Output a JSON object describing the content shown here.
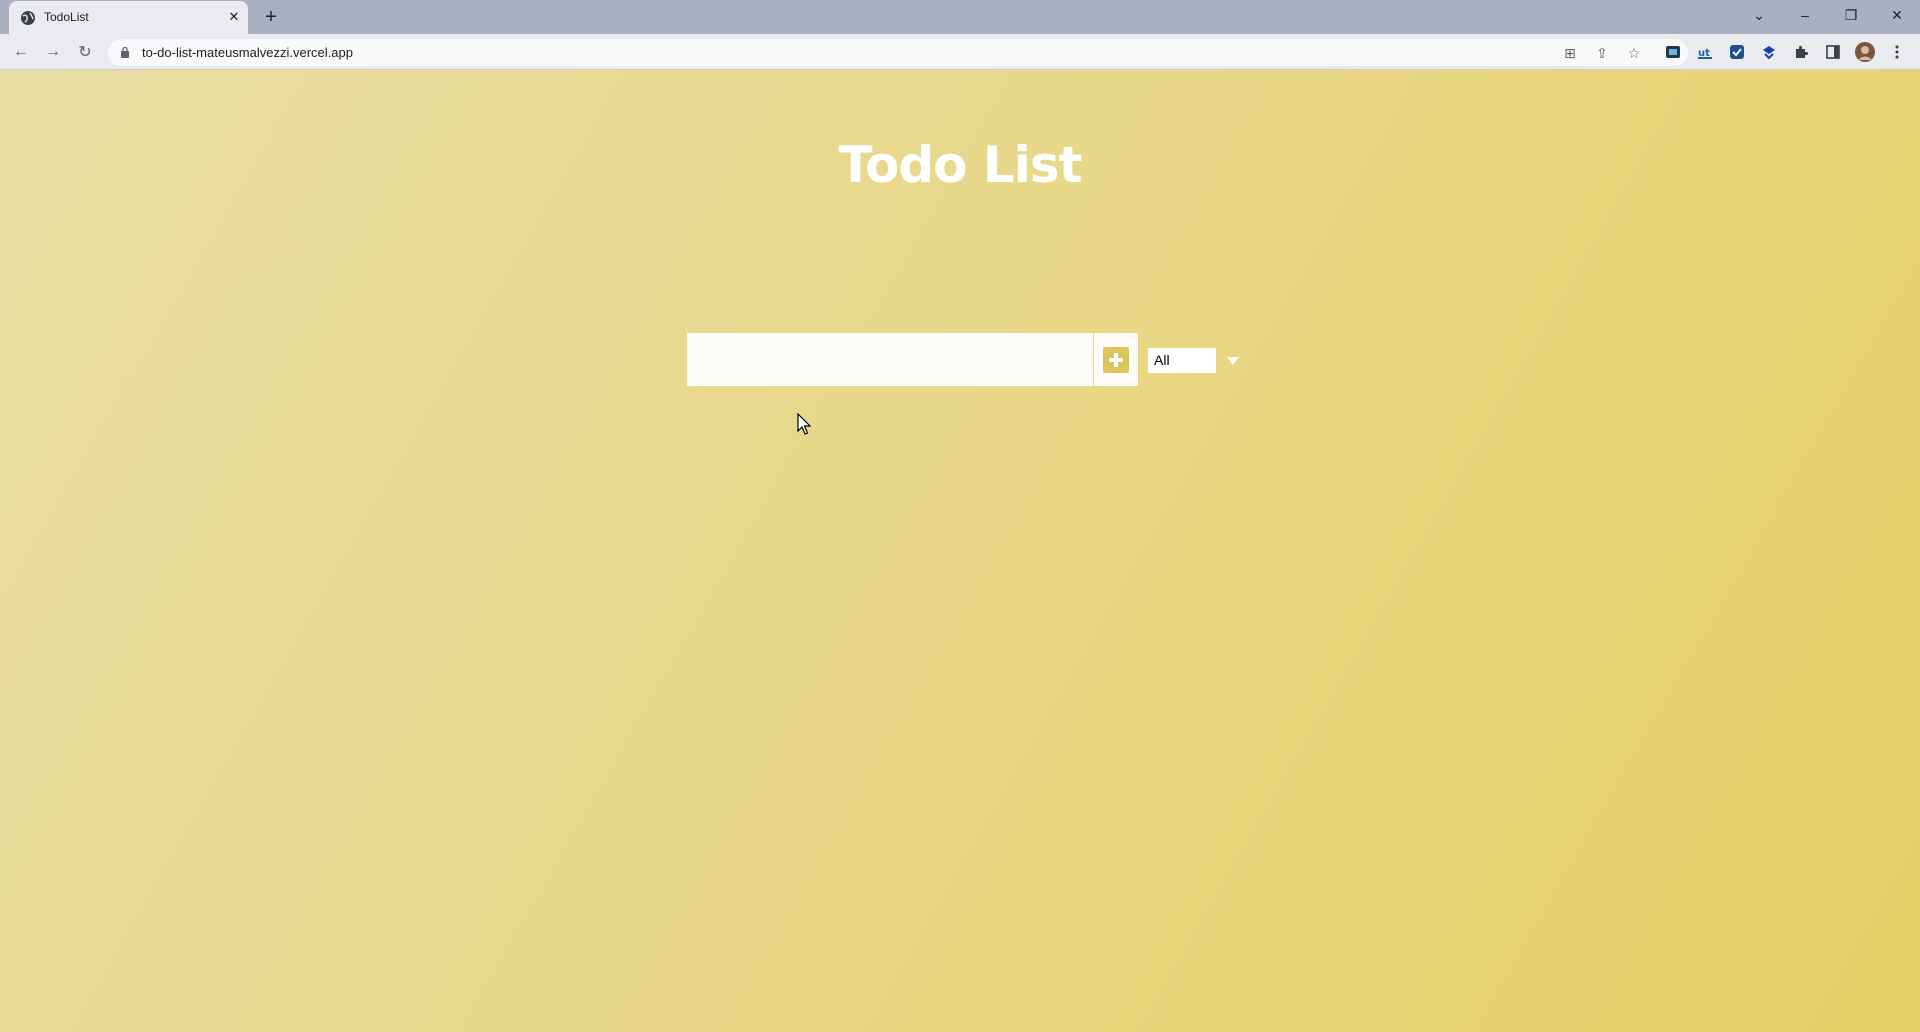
{
  "browser": {
    "tab_title": "TodoList",
    "tab_close_icon": "close-icon",
    "new_tab_icon": "plus-icon",
    "url": "to-do-list-mateusmalvezzi.vercel.app",
    "window_controls": [
      "chevron-down-icon",
      "minimize-icon",
      "restore-icon",
      "close-icon"
    ],
    "nav_icons": [
      "back-arrow-icon",
      "forward-arrow-icon",
      "reload-icon"
    ],
    "omnibox_icons": [
      "translate-icon",
      "share-icon",
      "star-icon"
    ],
    "extension_icons": [
      "extension-1-icon",
      "extension-2-icon",
      "extension-3-icon",
      "extension-4-icon",
      "puzzle-icon",
      "side-panel-icon",
      "avatar",
      "kebab-menu-icon"
    ]
  },
  "app": {
    "title": "Todo List",
    "input_value": "",
    "add_icon": "plus-icon",
    "filter": {
      "selected": "All",
      "arrow_icon": "caret-down-icon"
    }
  },
  "colors": {
    "background_start": "#e9dea4",
    "background_end": "#e5d064",
    "accent": "#ddc45d",
    "title": "#ffffff"
  }
}
